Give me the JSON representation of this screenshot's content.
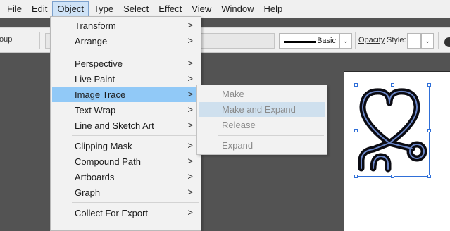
{
  "menubar": {
    "items": [
      "File",
      "Edit",
      "Object",
      "Type",
      "Select",
      "Effect",
      "View",
      "Window",
      "Help"
    ],
    "active": "Object"
  },
  "controlbar": {
    "group_label": "oup",
    "stroke_profile": "Basic",
    "opacity_label": "Opacity",
    "style_label": "Style:"
  },
  "object_menu": {
    "items": [
      {
        "label": "Transform",
        "submenu": true
      },
      {
        "label": "Arrange",
        "submenu": true
      },
      {
        "label": "Perspective",
        "submenu": true
      },
      {
        "label": "Live Paint",
        "submenu": true
      },
      {
        "label": "Image Trace",
        "submenu": true,
        "highlighted": true
      },
      {
        "label": "Text Wrap",
        "submenu": true
      },
      {
        "label": "Line and Sketch Art",
        "submenu": true
      },
      {
        "label": "Clipping Mask",
        "submenu": true
      },
      {
        "label": "Compound Path",
        "submenu": true
      },
      {
        "label": "Artboards",
        "submenu": true
      },
      {
        "label": "Graph",
        "submenu": true
      },
      {
        "label": "Collect For Export",
        "submenu": true
      }
    ],
    "arrow_glyph": ">"
  },
  "image_trace_submenu": {
    "items": [
      {
        "label": "Make",
        "enabled": false
      },
      {
        "label": "Make and Expand",
        "enabled": false,
        "highlighted": true
      },
      {
        "label": "Release",
        "enabled": false
      },
      {
        "label": "Expand",
        "enabled": false
      }
    ]
  },
  "colors": {
    "menu_highlight": "#91c9f7",
    "submenu_highlight": "#cfe0ee",
    "canvas": "#535353",
    "selection": "#2f6fd8"
  },
  "icons": {
    "dropdown": "chevron-down-icon",
    "artwork": "heart-stethoscope-artwork"
  }
}
